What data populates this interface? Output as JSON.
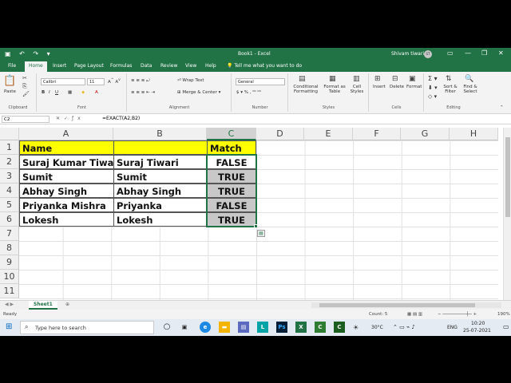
{
  "window": {
    "title": "Book1 - Excel",
    "user": "Shivam tiwari",
    "initials": "ST"
  },
  "tabs": [
    "File",
    "Home",
    "Insert",
    "Page Layout",
    "Formulas",
    "Data",
    "Review",
    "View",
    "Help"
  ],
  "tell_me": "Tell me what you want to do",
  "ribbon": {
    "clipboard": {
      "label": "Clipboard",
      "paste": "Paste"
    },
    "font": {
      "label": "Font",
      "name": "Calibri",
      "size": "11"
    },
    "alignment": {
      "label": "Alignment",
      "wrap": "Wrap Text",
      "merge": "Merge & Center"
    },
    "number": {
      "label": "Number",
      "format": "General"
    },
    "styles": {
      "label": "Styles",
      "conditional": "Conditional Formatting",
      "format_table": "Format as Table",
      "cell_styles": "Cell Styles"
    },
    "cells": {
      "label": "Cells",
      "insert": "Insert",
      "delete": "Delete",
      "format": "Format"
    },
    "editing": {
      "label": "Editing",
      "sort": "Sort & Filter",
      "find": "Find & Select"
    }
  },
  "formula_bar": {
    "name_box": "C2",
    "formula": "=EXACT(A2,B2)"
  },
  "columns": [
    "A",
    "B",
    "C",
    "D",
    "E",
    "F",
    "G",
    "H"
  ],
  "rows": [
    "1",
    "2",
    "3",
    "4",
    "5",
    "6",
    "7",
    "8",
    "9",
    "10",
    "11"
  ],
  "cells": {
    "A1": "Name",
    "B1": "",
    "C1": "Match",
    "A2": "Suraj Kumar Tiwari",
    "B2": "Suraj  Tiwari",
    "C2": "FALSE",
    "A3": "Sumit",
    "B3": "Sumit",
    "C3": "TRUE",
    "A4": "Abhay Singh",
    "B4": "Abhay Singh",
    "C4": "TRUE",
    "A5": "Priyanka Mishra",
    "B5": "Priyanka",
    "C5": "FALSE",
    "A6": "Lokesh",
    "B6": "Lokesh",
    "C6": "TRUE"
  },
  "sheet": {
    "tab": "Sheet1"
  },
  "status": {
    "ready": "Ready",
    "count": "Count: 5",
    "zoom": "190%"
  },
  "taskbar": {
    "search": "Type here to search",
    "weather": "30°C",
    "lang": "ENG",
    "time": "10:20",
    "date": "25-07-2021"
  },
  "colors": {
    "excel_green": "#217346",
    "header_fill": "#ffff00",
    "selection_fill": "#c8c8c8"
  }
}
